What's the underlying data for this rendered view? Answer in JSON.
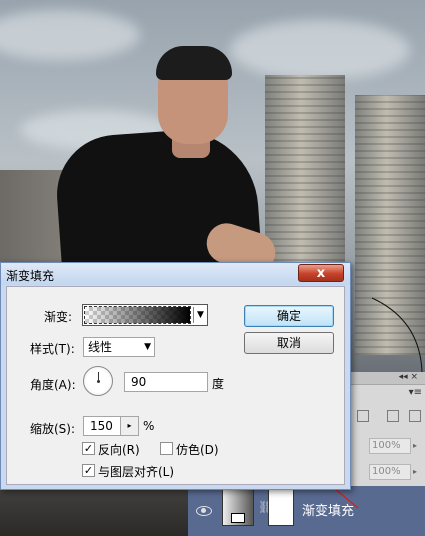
{
  "dialog": {
    "title": "渐变填充",
    "close_label": "x",
    "gradient_label": "渐变:",
    "style_label": "样式(T):",
    "style_value": "线性",
    "angle_label": "角度(A):",
    "angle_value": "90",
    "angle_unit": "度",
    "scale_label": "缩放(S):",
    "scale_value": "150",
    "scale_unit": "%",
    "reverse_label": "反向(R)",
    "reverse_checked": true,
    "dither_label": "仿色(D)",
    "dither_checked": false,
    "align_label": "与图层对齐(L)",
    "align_checked": true,
    "ok_label": "确定",
    "cancel_label": "取消"
  },
  "layers_panel": {
    "opacity_value": "100%",
    "fill_value": "100%",
    "layer_name": "渐变填充"
  }
}
